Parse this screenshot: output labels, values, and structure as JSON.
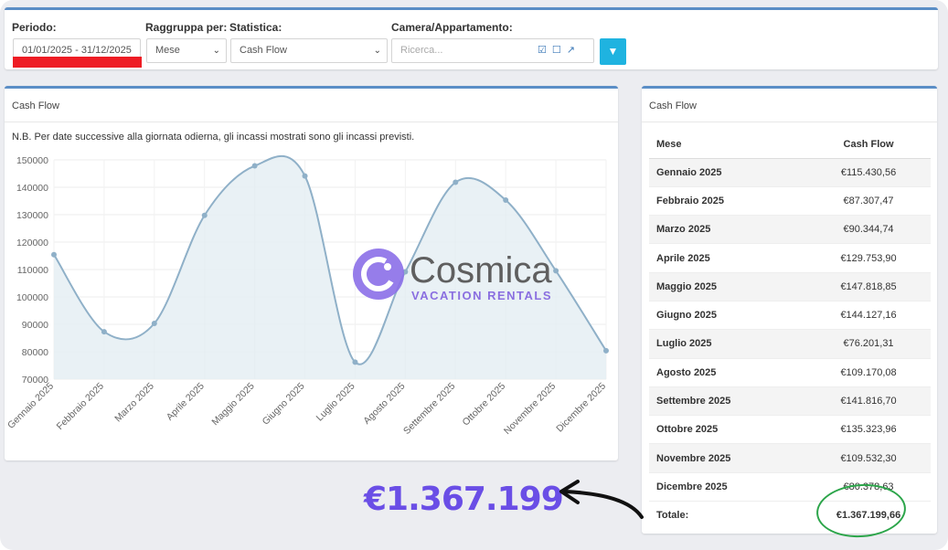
{
  "filters": {
    "period_label": "Periodo:",
    "period_value": "01/01/2025 - 31/12/2025",
    "group_label": "Raggruppa per:",
    "group_value": "Mese",
    "stat_label": "Statistica:",
    "stat_value": "Cash Flow",
    "room_label": "Camera/Appartamento:",
    "room_placeholder": "Ricerca..."
  },
  "chart_panel": {
    "title": "Cash Flow",
    "note": "N.B. Per date successive alla giornata odierna, gli incassi mostrati sono gli incassi previsti."
  },
  "chart_data": {
    "type": "area",
    "categories": [
      "Gennaio 2025",
      "Febbraio 2025",
      "Marzo 2025",
      "Aprile 2025",
      "Maggio 2025",
      "Giugno 2025",
      "Luglio 2025",
      "Agosto 2025",
      "Settembre 2025",
      "Ottobre 2025",
      "Novembre 2025",
      "Dicembre 2025"
    ],
    "values": [
      115430.56,
      87307.47,
      90344.74,
      129753.9,
      147818.85,
      144127.16,
      76201.31,
      109170.08,
      141816.7,
      135323.96,
      109532.3,
      80378.63
    ],
    "yticks": [
      "150000",
      "140000",
      "130000",
      "120000",
      "110000",
      "100000",
      "90000",
      "80000",
      "70000"
    ],
    "ylim": [
      70000,
      150000
    ],
    "grid": true,
    "colors": {
      "line": "#8fb0c8",
      "fill": "#e4edf3",
      "point": "#8fb0c8"
    }
  },
  "table_panel": {
    "title": "Cash Flow",
    "col_month": "Mese",
    "col_value": "Cash Flow",
    "rows": [
      {
        "month": "Gennaio 2025",
        "value": "€115.430,56"
      },
      {
        "month": "Febbraio 2025",
        "value": "€87.307,47"
      },
      {
        "month": "Marzo 2025",
        "value": "€90.344,74"
      },
      {
        "month": "Aprile 2025",
        "value": "€129.753,90"
      },
      {
        "month": "Maggio 2025",
        "value": "€147.818,85"
      },
      {
        "month": "Giugno 2025",
        "value": "€144.127,16"
      },
      {
        "month": "Luglio 2025",
        "value": "€76.201,31"
      },
      {
        "month": "Agosto 2025",
        "value": "€109.170,08"
      },
      {
        "month": "Settembre 2025",
        "value": "€141.816,70"
      },
      {
        "month": "Ottobre 2025",
        "value": "€135.323,96"
      },
      {
        "month": "Novembre 2025",
        "value": "€109.532,30"
      },
      {
        "month": "Dicembre 2025",
        "value": "€80.378,63"
      }
    ],
    "total_label": "Totale:",
    "total_value": "€1.367.199,66"
  },
  "overlay": {
    "logo_name": "Cosmica",
    "logo_tagline": "VACATION RENTALS",
    "big_total": "€1.367.199",
    "accent": "#6a4ee6",
    "highlight": "#2ca54a"
  }
}
